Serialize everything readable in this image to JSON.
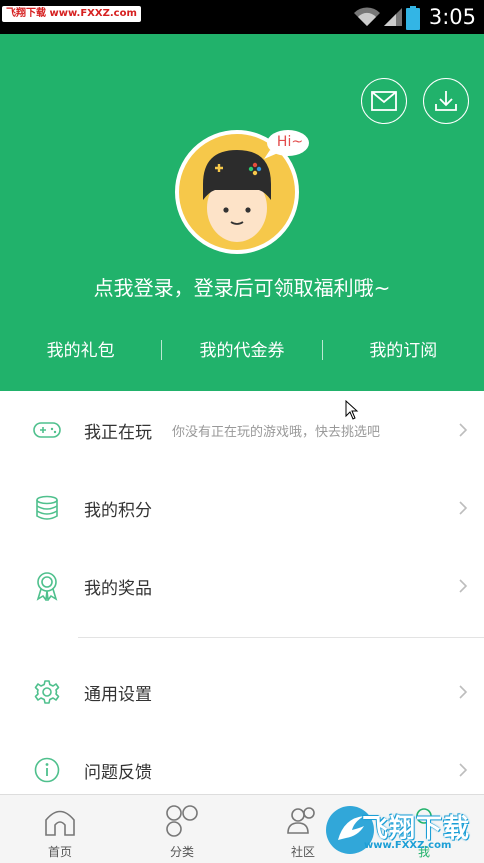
{
  "status_bar": {
    "watermark": "飞翔下载 www.FXXZ.com",
    "time": "3:05",
    "icons": [
      "wifi-icon",
      "signal-icon",
      "battery-icon"
    ]
  },
  "header": {
    "mail_icon": "mail-icon",
    "download_icon": "download-icon",
    "bubble_text": "Hi~",
    "login_prompt": "点我登录，登录后可领取福利哦~",
    "tabs": [
      {
        "label": "我的礼包"
      },
      {
        "label": "我的代金券"
      },
      {
        "label": "我的订阅"
      }
    ]
  },
  "menu": {
    "items": [
      {
        "label": "我正在玩",
        "sub": "你没有正在玩的游戏哦，快去挑选吧",
        "icon": "gamepad-icon"
      },
      {
        "label": "我的积分",
        "icon": "coins-icon"
      },
      {
        "label": "我的奖品",
        "icon": "award-icon"
      },
      {
        "label": "通用设置",
        "icon": "gear-icon"
      },
      {
        "label": "问题反馈",
        "icon": "info-icon"
      }
    ]
  },
  "bottom_nav": {
    "items": [
      {
        "label": "首页",
        "icon": "home-icon"
      },
      {
        "label": "分类",
        "icon": "category-icon"
      },
      {
        "label": "社区",
        "icon": "community-icon"
      },
      {
        "label": "我",
        "icon": "profile-icon"
      }
    ]
  },
  "overlay_watermark": {
    "brand": "飞翔下载",
    "url": "www.FXXZ.com"
  },
  "colors": {
    "accent": "#21b26b",
    "avatar_bg": "#f6c84a",
    "chevron": "#bdbdbd",
    "icon_green": "#4fc08d"
  }
}
